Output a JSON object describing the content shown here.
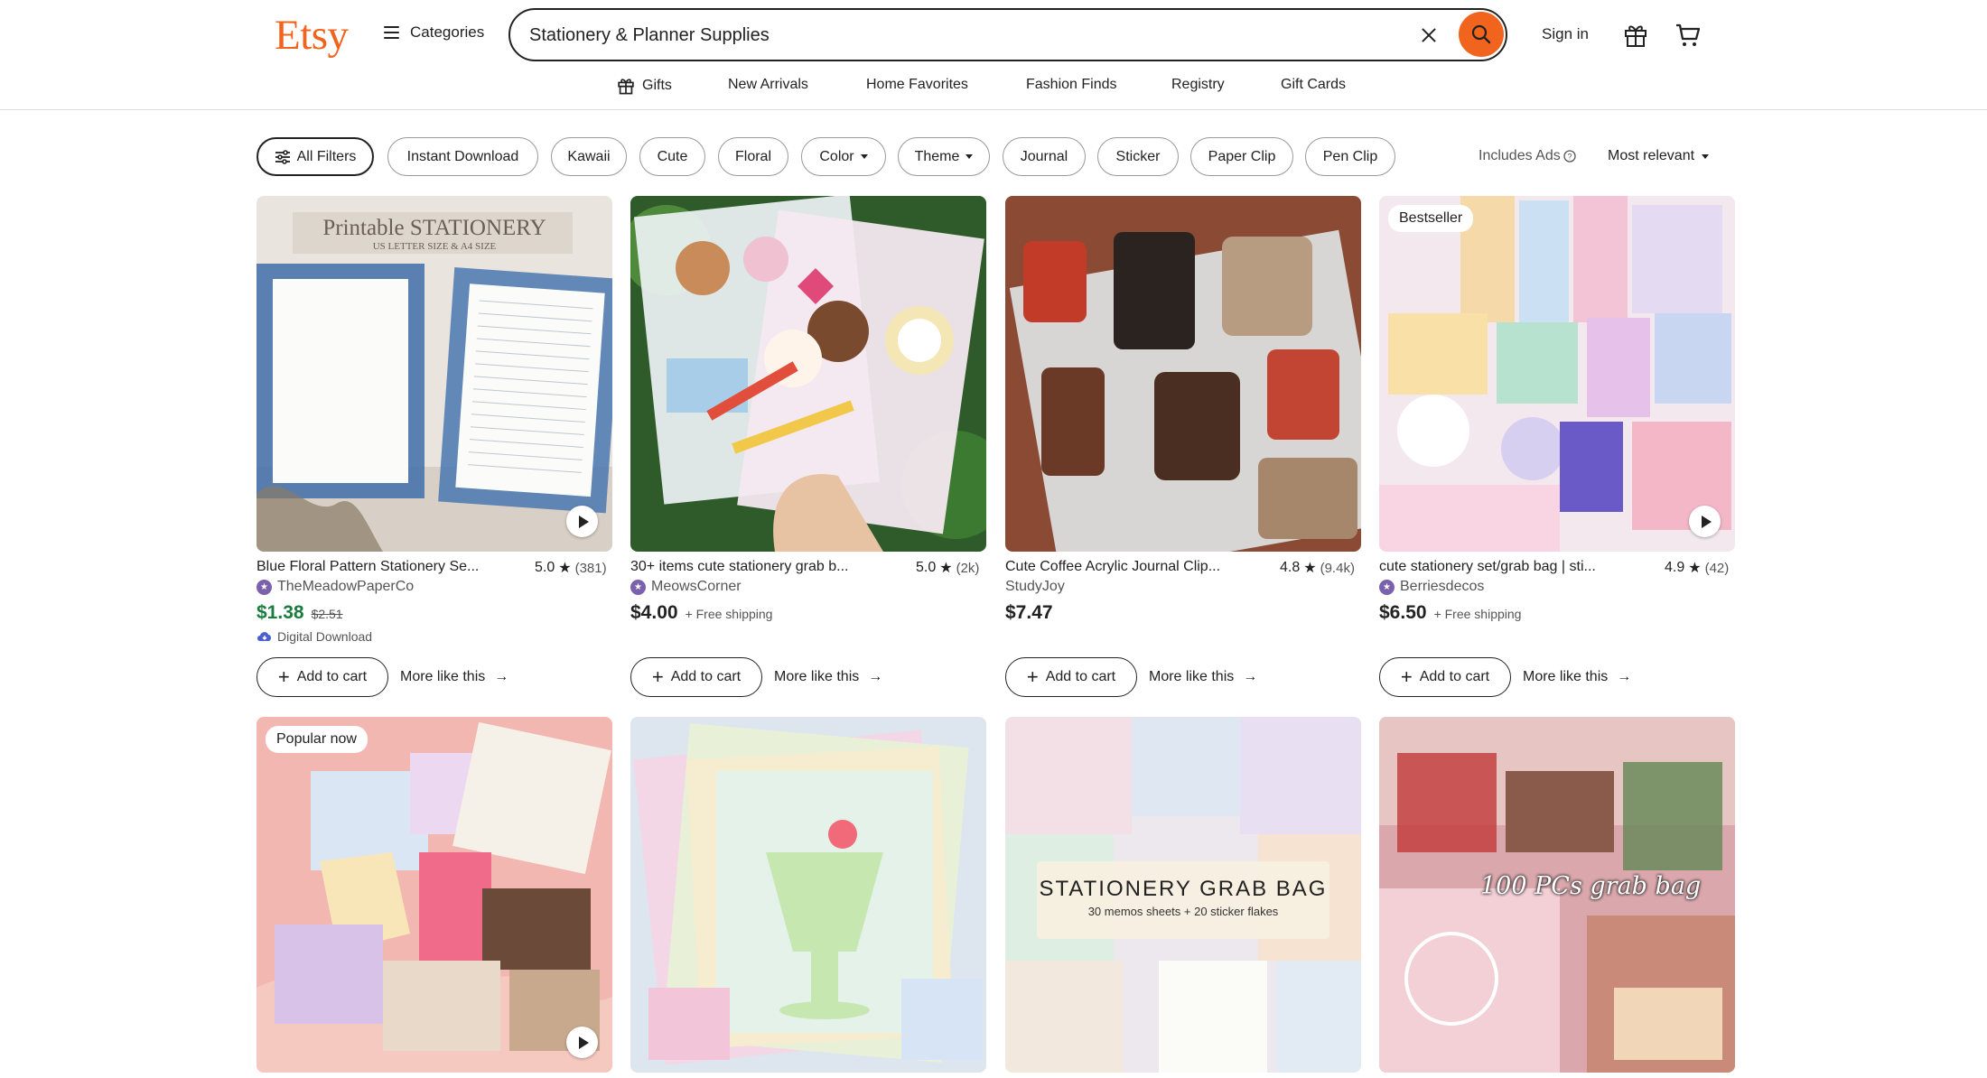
{
  "header": {
    "logo": "Etsy",
    "categories": "Categories",
    "search_value": "Stationery & Planner Supplies",
    "signin": "Sign in"
  },
  "subnav": [
    "Gifts",
    "New Arrivals",
    "Home Favorites",
    "Fashion Finds",
    "Registry",
    "Gift Cards"
  ],
  "filters": [
    "All Filters",
    "Instant Download",
    "Kawaii",
    "Cute",
    "Floral",
    "Color",
    "Theme",
    "Journal",
    "Sticker",
    "Paper Clip",
    "Pen Clip"
  ],
  "ads_note": "Includes Ads",
  "sort": "Most relevant",
  "card_actions": {
    "add_to_cart": "Add to cart",
    "more_like_this": "More like this"
  },
  "listings": [
    {
      "title": "Blue Floral Pattern Stationery Se...",
      "rating": "5.0",
      "reviews": "(381)",
      "shop": "TheMeadowPaperCo",
      "price": "$1.38",
      "original_price": "$2.51",
      "digital": "Digital Download",
      "image_caption": "Printable STATIONERY",
      "image_subcaption": "US LETTER SIZE & A4 SIZE"
    },
    {
      "title": "30+ items cute stationery grab b...",
      "rating": "5.0",
      "reviews": "(2k)",
      "shop": "MeowsCorner",
      "price": "$4.00",
      "shipping": "+ Free shipping"
    },
    {
      "title": "Cute Coffee Acrylic Journal Clip...",
      "rating": "4.8",
      "reviews": "(9.4k)",
      "shop": "StudyJoy",
      "price": "$7.47"
    },
    {
      "title": "cute stationery set/grab bag | sti...",
      "rating": "4.9",
      "reviews": "(42)",
      "shop": "Berriesdecos",
      "price": "$6.50",
      "shipping": "+ Free shipping",
      "badge": "Bestseller"
    },
    {
      "badge": "Popular now"
    },
    {},
    {
      "image_caption": "STATIONERY GRAB BAG",
      "image_subcaption": "30 memos sheets + 20 sticker flakes"
    },
    {
      "image_caption": "100 PCs grab bag"
    }
  ]
}
